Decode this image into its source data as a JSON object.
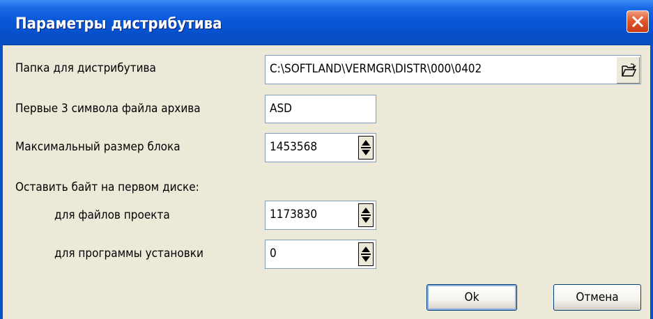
{
  "window": {
    "title": "Параметры дистрибутива",
    "close_label": "Close"
  },
  "form": {
    "folder_label": "Папка для дистрибутива",
    "folder_value": "C:\\SOFTLAND\\VERMGR\\DISTR\\000\\0402",
    "prefix_label": "Первые 3 символа файла архива",
    "prefix_value": "ASD",
    "block_label": "Максимальный размер блока",
    "block_value": "1453568",
    "reserve_heading": "Оставить байт на первом диске:",
    "project_label": "для файлов проекта",
    "project_value": "1173830",
    "setup_label": "для программы установки",
    "setup_value": "0"
  },
  "buttons": {
    "ok": "Ok",
    "cancel": "Отмена"
  },
  "icons": {
    "close": "close-icon",
    "browse": "folder-open-icon",
    "spinner": "spinner-arrows-icon"
  }
}
